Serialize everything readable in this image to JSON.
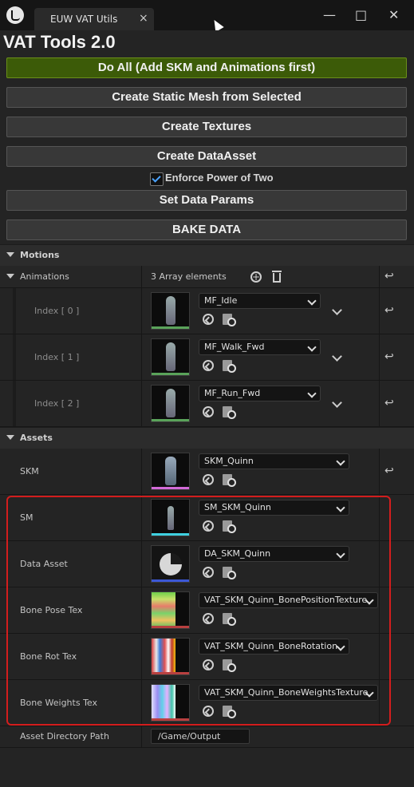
{
  "window": {
    "tab_label": "EUW VAT Utils",
    "tab_close": "×",
    "minimize": "—",
    "maximize": "□",
    "close": "✕"
  },
  "heading": "VAT Tools 2.0",
  "buttons": {
    "do_all": "Do All (Add SKM and Animations first)",
    "create_static_mesh": "Create Static Mesh from Selected",
    "create_textures": "Create Textures",
    "create_data_asset": "Create DataAsset",
    "set_data_params": "Set Data Params",
    "bake_data": "BAKE DATA"
  },
  "enforce_power_of_two": {
    "label": "Enforce Power of Two",
    "checked": true
  },
  "motions": {
    "section_label": "Motions",
    "animations_label": "Animations",
    "array_count": "3 Array elements",
    "items": [
      {
        "index_label": "Index [ 0 ]",
        "asset": "MF_Idle"
      },
      {
        "index_label": "Index [ 1 ]",
        "asset": "MF_Walk_Fwd"
      },
      {
        "index_label": "Index [ 2 ]",
        "asset": "MF_Run_Fwd"
      }
    ]
  },
  "assets": {
    "section_label": "Assets",
    "rows": [
      {
        "label": "SKM",
        "asset": "SKM_Quinn"
      },
      {
        "label": "SM",
        "asset": "SM_SKM_Quinn"
      },
      {
        "label": "Data Asset",
        "asset": "DA_SKM_Quinn"
      },
      {
        "label": "Bone Pose Tex",
        "asset": "VAT_SKM_Quinn_BonePositionTexture"
      },
      {
        "label": "Bone Rot Tex",
        "asset": "VAT_SKM_Quinn_BoneRotation"
      },
      {
        "label": "Bone Weights Tex",
        "asset": "VAT_SKM_Quinn_BoneWeightsTexture"
      }
    ],
    "directory_label": "Asset Directory Path",
    "directory_value": "/Game/Output"
  },
  "colors": {
    "accent_green": "#3c5b08",
    "highlight_red": "#d31d1d",
    "anim_stripe": "#5aa35a",
    "skm_stripe": "#d36ad8",
    "sm_stripe": "#3fd1e0",
    "da_stripe": "#3c58d6",
    "tex_stripe": "#b84040"
  }
}
